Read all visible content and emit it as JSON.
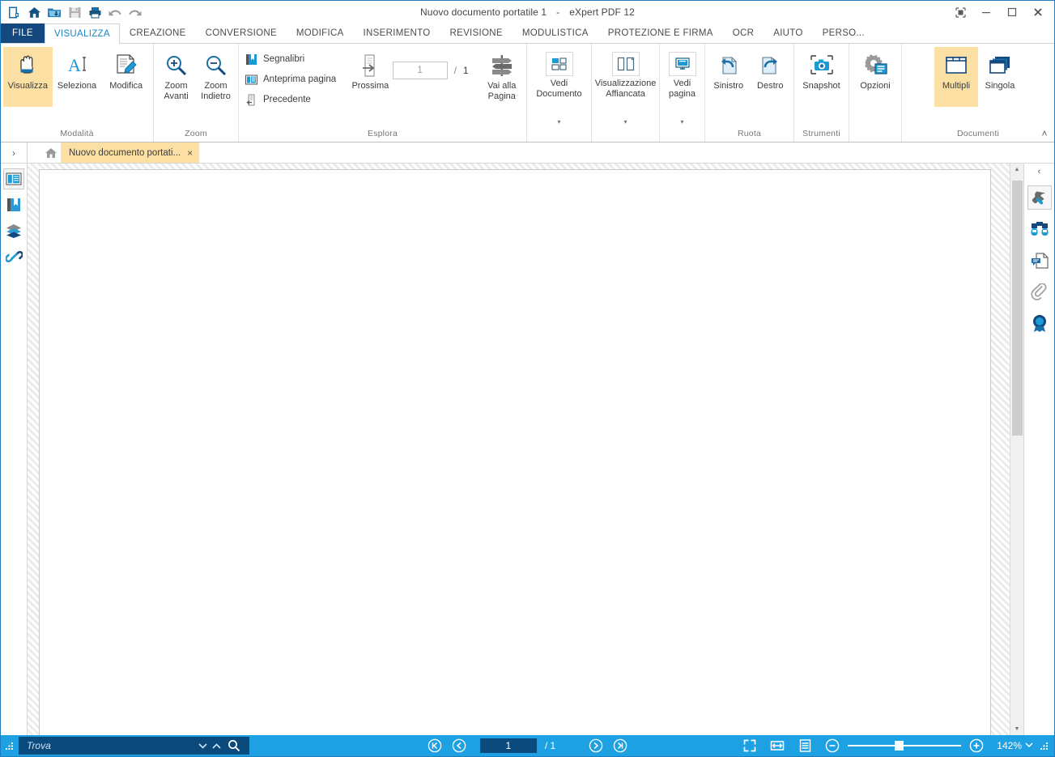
{
  "window": {
    "title_doc": "Nuovo documento portatile 1",
    "title_dash": "-",
    "title_app": "eXpert PDF 12",
    "controls": {
      "ribbon_options": "ribbon-display-options",
      "minimize": "minimize",
      "maximize": "maximize",
      "close": "close"
    }
  },
  "quick_access": [
    {
      "name": "new-pdf-icon",
      "tip": "Nuovo"
    },
    {
      "name": "home-icon",
      "tip": "Home"
    },
    {
      "name": "open-folder-icon",
      "tip": "Apri"
    },
    {
      "name": "save-icon",
      "tip": "Salva"
    },
    {
      "name": "print-icon",
      "tip": "Stampa"
    },
    {
      "name": "undo-icon",
      "tip": "Annulla"
    },
    {
      "name": "redo-icon",
      "tip": "Ripeti"
    }
  ],
  "tabs": {
    "file_label": "FILE",
    "items": [
      {
        "label": "VISUALIZZA",
        "active": true
      },
      {
        "label": "CREAZIONE",
        "active": false
      },
      {
        "label": "CONVERSIONE",
        "active": false
      },
      {
        "label": "MODIFICA",
        "active": false
      },
      {
        "label": "INSERIMENTO",
        "active": false
      },
      {
        "label": "REVISIONE",
        "active": false
      },
      {
        "label": "MODULISTICA",
        "active": false
      },
      {
        "label": "PROTEZIONE E FIRMA",
        "active": false
      },
      {
        "label": "OCR",
        "active": false
      },
      {
        "label": "AIUTO",
        "active": false
      },
      {
        "label": "PERSO...",
        "active": false
      }
    ]
  },
  "ribbon": {
    "groups": {
      "modalita": {
        "label": "Modalità",
        "buttons": [
          {
            "label": "Visualizza",
            "icon": "hand-icon",
            "selected": true
          },
          {
            "label": "Seleziona",
            "icon": "text-select-icon",
            "selected": false
          },
          {
            "label": "Modifica",
            "icon": "edit-document-icon",
            "selected": false
          }
        ]
      },
      "zoom": {
        "label": "Zoom",
        "buttons": [
          {
            "label": "Zoom\nAvanti",
            "line1": "Zoom",
            "line2": "Avanti",
            "icon": "zoom-in-icon"
          },
          {
            "label": "Zoom\nIndietro",
            "line1": "Zoom",
            "line2": "Indietro",
            "icon": "zoom-out-icon"
          }
        ]
      },
      "esplora": {
        "label": "Esplora",
        "small_buttons": [
          {
            "label": "Segnalibri",
            "icon": "bookmark-icon"
          },
          {
            "label": "Anteprima pagina",
            "icon": "page-preview-icon"
          },
          {
            "label": "Precedente",
            "icon": "previous-page-icon"
          }
        ],
        "next_button": {
          "label": "Prossima",
          "icon": "next-page-icon"
        },
        "page_input": {
          "value": "1",
          "placeholder": "1"
        },
        "page_separator": "/",
        "page_total": "1",
        "goto_button": {
          "line1": "Vai alla",
          "line2": "Pagina",
          "icon": "signpost-icon"
        }
      },
      "vedi_documento": {
        "line1": "Vedi",
        "line2": "Documento",
        "icon": "document-view-icon",
        "caret": "▾"
      },
      "visualizzazione_affiancata": {
        "line1": "Visualizzazione",
        "line2": "Affiancata",
        "icon": "side-by-side-icon",
        "caret": "▾"
      },
      "vedi_pagina": {
        "line1": "Vedi",
        "line2": "pagina",
        "icon": "page-view-icon",
        "caret": "▾"
      },
      "ruota": {
        "label": "Ruota",
        "buttons": [
          {
            "label": "Sinistro",
            "icon": "rotate-left-icon"
          },
          {
            "label": "Destro",
            "icon": "rotate-right-icon"
          }
        ]
      },
      "strumenti": {
        "label": "Strumenti",
        "buttons": [
          {
            "label": "Snapshot",
            "icon": "camera-snapshot-icon"
          }
        ]
      },
      "opzioni": {
        "buttons": [
          {
            "label": "Opzioni",
            "icon": "gear-options-icon"
          }
        ]
      },
      "documenti": {
        "label": "Documenti",
        "buttons": [
          {
            "label": "Multipli",
            "icon": "multiple-documents-icon",
            "selected": true
          },
          {
            "label": "Singola",
            "icon": "single-document-icon",
            "selected": false
          }
        ],
        "collapse_caret": "˄"
      }
    }
  },
  "doc_tabbar": {
    "expand_sidebar": "›",
    "home_icon": "home-tab-icon",
    "tab": {
      "title": "Nuovo documento portati...",
      "close": "×"
    }
  },
  "left_sidebar": [
    {
      "name": "page-thumbnails-icon",
      "selected": true
    },
    {
      "name": "bookmarks-icon",
      "selected": false
    },
    {
      "name": "layers-icon",
      "selected": false
    },
    {
      "name": "links-icon",
      "selected": false
    }
  ],
  "right_sidebar": {
    "collapse": "‹",
    "items": [
      {
        "name": "tools-wrench-icon",
        "selected": true
      },
      {
        "name": "binoculars-search-icon",
        "selected": false
      },
      {
        "name": "comments-icon",
        "selected": false
      },
      {
        "name": "attachments-paperclip-icon",
        "selected": false
      },
      {
        "name": "signature-seal-icon",
        "selected": false
      }
    ]
  },
  "status_bar": {
    "find": {
      "placeholder": "Trova",
      "value": ""
    },
    "find_prev_caret": "⌄",
    "find_next_caret": "⌃",
    "navigation": {
      "first": "first-page",
      "prev": "previous-page",
      "page_value": "1",
      "page_total": "/ 1",
      "next": "next-page",
      "last": "last-page"
    },
    "view_icons": [
      {
        "name": "fit-page-icon"
      },
      {
        "name": "fit-width-icon"
      },
      {
        "name": "continuous-scroll-icon"
      }
    ],
    "zoom": {
      "out": "zoom-out",
      "in": "zoom-in",
      "level": "142%",
      "caret": "⌄"
    }
  },
  "colors": {
    "accent_blue": "#1da1e2",
    "dark_blue": "#14487f",
    "highlight_orange": "#fbdfa3",
    "tab_active_text": "#1b84c7"
  }
}
